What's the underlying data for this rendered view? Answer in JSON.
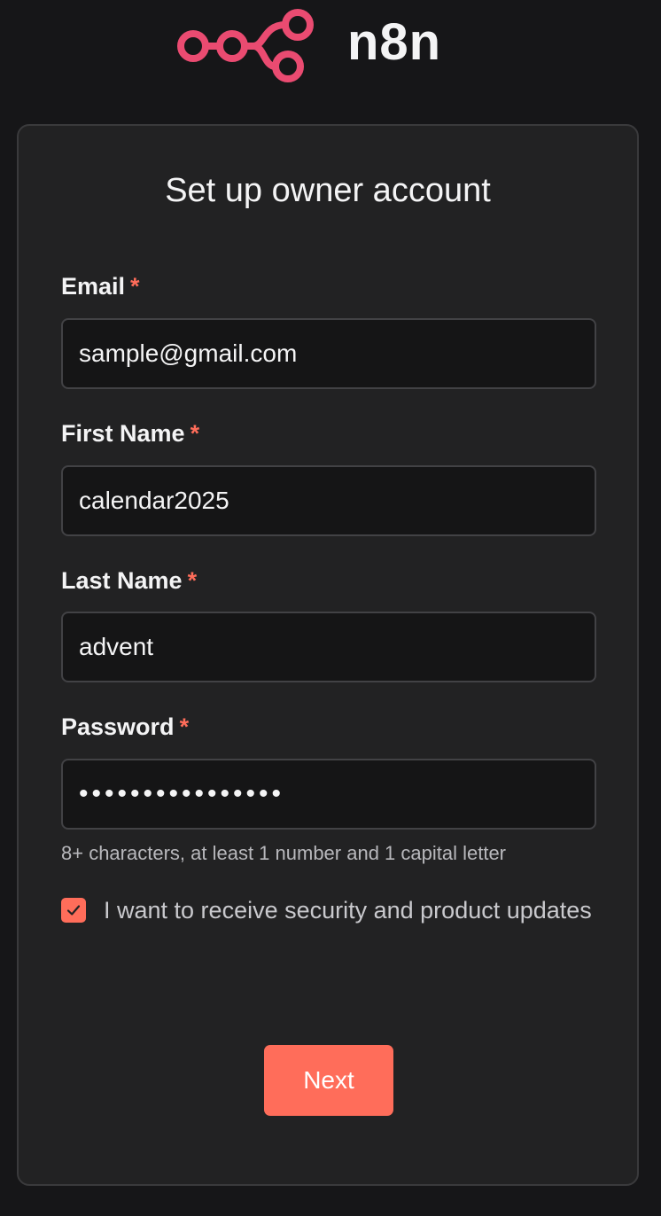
{
  "brand": {
    "name": "n8n",
    "logo_icon": "n8n-nodes-icon",
    "accent_color": "#ea4b71"
  },
  "form": {
    "title": "Set up owner account",
    "required_marker": "*",
    "fields": [
      {
        "label": "Email",
        "value": "sample@gmail.com"
      },
      {
        "label": "First Name",
        "value": "calendar2025"
      },
      {
        "label": "Last Name",
        "value": "advent"
      },
      {
        "label": "Password",
        "value": "••••••••••••••••"
      }
    ],
    "password_hint": "8+ characters, at least 1 number and 1 capital letter",
    "updates_checkbox": {
      "checked": true,
      "label": "I want to receive security and product updates"
    },
    "submit_label": "Next",
    "button_color": "#ff6d5a"
  }
}
